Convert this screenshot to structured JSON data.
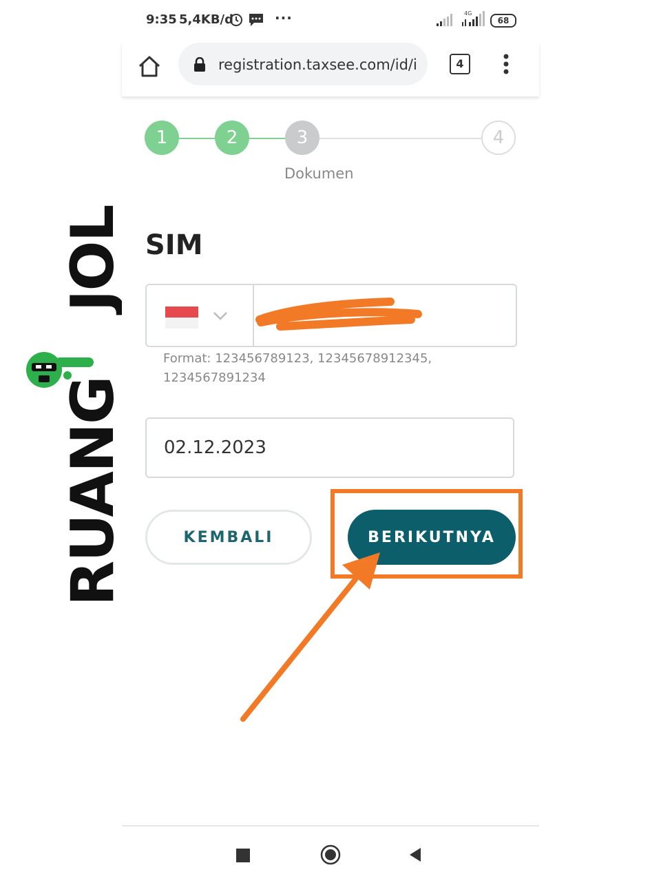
{
  "status_bar": {
    "time": "9:35",
    "speed": "5,4KB/d",
    "dots": "···",
    "network": "4G",
    "battery": "68"
  },
  "browser": {
    "url": "registration.taxsee.com/id/i",
    "tab_count": "4"
  },
  "stepper": {
    "steps": [
      "1",
      "2",
      "3",
      "4"
    ],
    "current_label": "Dokumen",
    "completed_color": "#7ed190",
    "current_color": "#c9cbcc"
  },
  "form": {
    "title": "SIM",
    "phone_value": "",
    "format_hint": "Format: 123456789123, 12345678912345, 1234567891234",
    "date_value": "02.12.2023"
  },
  "buttons": {
    "back_label": "KEMBALI",
    "next_label": "BERIKUTNYA"
  },
  "watermark": {
    "word1": "RUANG",
    "word2": "JOL"
  },
  "colors": {
    "accent": "#0d5e6b",
    "annotation": "#f27a27"
  }
}
